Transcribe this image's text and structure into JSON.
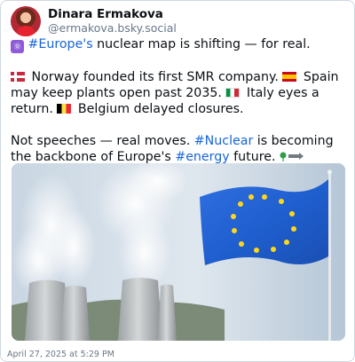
{
  "author": {
    "display_name": "Dinara Ermakova",
    "handle": "@ermakova.bsky.social"
  },
  "post": {
    "line1": {
      "icon": "atom-icon",
      "hashtag": "#Europe's",
      "text": " nuclear map is shifting — for real."
    },
    "line2": {
      "norway": " Norway founded its first SMR company. ",
      "spain": " Spain may keep plants open past 2035. ",
      "italy": " Italy eyes a return. ",
      "belgium": " Belgium delayed closures."
    },
    "line3": {
      "text_a": "Not speeches — real moves. ",
      "hashtag_nuclear": "#Nuclear",
      "text_b": " is becoming the backbone of Europe's ",
      "hashtag_energy": "#energy",
      "text_c": " future."
    }
  },
  "image": {
    "subject": "Nuclear cooling towers with steam and EU flag on a pole"
  },
  "timestamp": "April 27, 2025 at 5:29 PM",
  "colors": {
    "hashtag": "#1765d8",
    "eu_blue": "#1f5fcf",
    "eu_star": "#ffd71a"
  }
}
